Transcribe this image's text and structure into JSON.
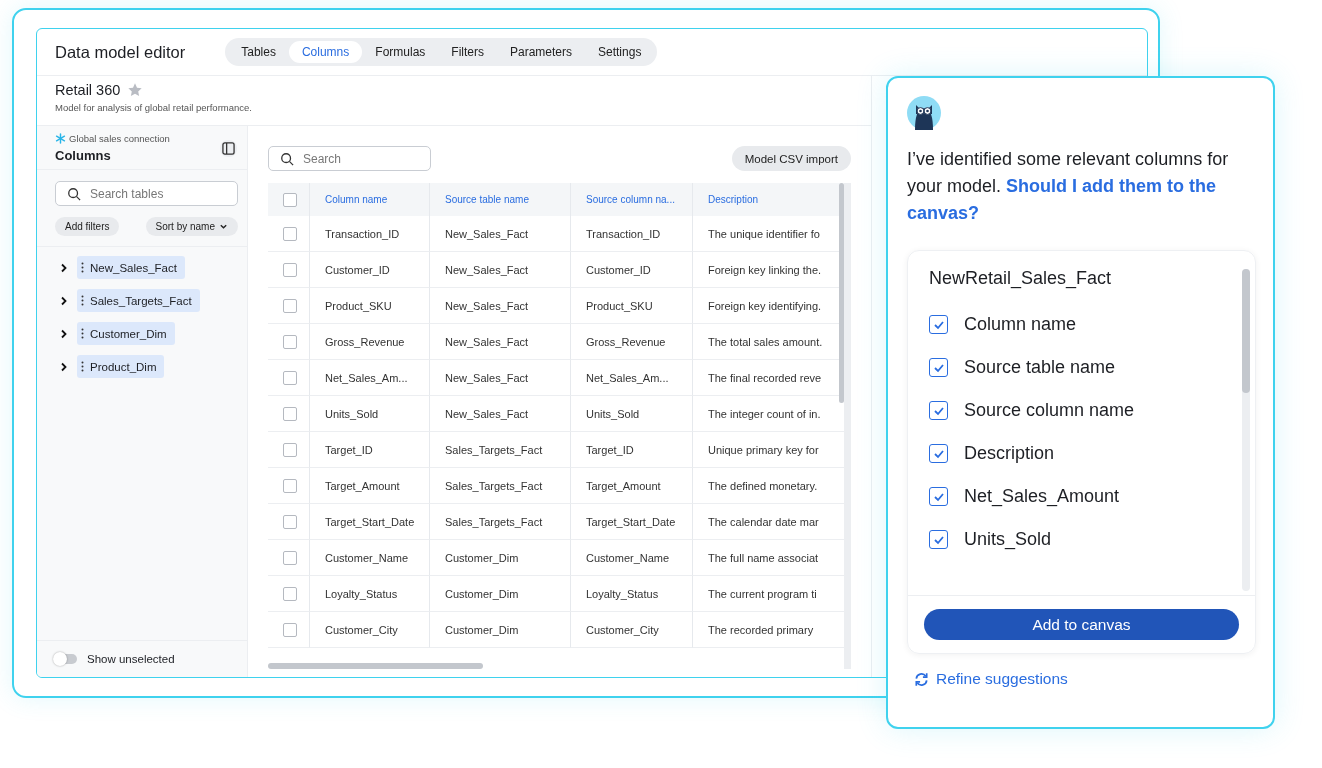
{
  "app": {
    "title": "Data model editor"
  },
  "tabs": [
    {
      "label": "Tables",
      "selected": false
    },
    {
      "label": "Columns",
      "selected": true
    },
    {
      "label": "Formulas",
      "selected": false
    },
    {
      "label": "Filters",
      "selected": false
    },
    {
      "label": "Parameters",
      "selected": false
    },
    {
      "label": "Settings",
      "selected": false
    }
  ],
  "model": {
    "name": "Retail 360",
    "starred": false,
    "description": "Model for analysis of global retail performance."
  },
  "sidebar": {
    "connection": "Global sales connection",
    "title": "Columns",
    "search": {
      "placeholder": "Search tables"
    },
    "buttons": [
      {
        "label": "Add filters",
        "kind": "plain"
      },
      {
        "label": "Sort by name",
        "kind": "dropdown"
      }
    ],
    "tables": [
      {
        "name": "New_Sales_Fact",
        "expanded": false
      },
      {
        "name": "Sales_Targets_Fact",
        "expanded": false
      },
      {
        "name": "Customer_Dim",
        "expanded": false
      },
      {
        "name": "Product_Dim",
        "expanded": false
      }
    ],
    "toggle": {
      "label": "Show unselected",
      "on": false
    }
  },
  "main": {
    "search": {
      "placeholder": "Search"
    },
    "import_button": "Model CSV import",
    "table": {
      "all_checked": false,
      "columns": [
        "Column name",
        "Source table name",
        "Source column na...",
        "Description"
      ],
      "rows": [
        {
          "checked": false,
          "cells": [
            "Transaction_ID",
            "New_Sales_Fact",
            "Transaction_ID",
            "The unique identifier fo"
          ]
        },
        {
          "checked": false,
          "cells": [
            "Customer_ID",
            "New_Sales_Fact",
            "Customer_ID",
            "Foreign key linking the."
          ]
        },
        {
          "checked": false,
          "cells": [
            "Product_SKU",
            "New_Sales_Fact",
            "Product_SKU",
            "Foreign key identifying."
          ]
        },
        {
          "checked": false,
          "cells": [
            "Gross_Revenue",
            "New_Sales_Fact",
            "Gross_Revenue",
            "The total sales amount."
          ]
        },
        {
          "checked": false,
          "cells": [
            "Net_Sales_Am...",
            "New_Sales_Fact",
            "Net_Sales_Am...",
            "The final recorded reve"
          ]
        },
        {
          "checked": false,
          "cells": [
            "Units_Sold",
            "New_Sales_Fact",
            "Units_Sold",
            "The integer count of in."
          ]
        },
        {
          "checked": false,
          "cells": [
            "Target_ID",
            "Sales_Targets_Fact",
            "Target_ID",
            "Unique primary key for"
          ]
        },
        {
          "checked": false,
          "cells": [
            "Target_Amount",
            "Sales_Targets_Fact",
            "Target_Amount",
            "The defined monetary."
          ]
        },
        {
          "checked": false,
          "cells": [
            "Target_Start_Date",
            "Sales_Targets_Fact",
            "Target_Start_Date",
            "The calendar date mar"
          ]
        },
        {
          "checked": false,
          "cells": [
            "Customer_Name",
            "Customer_Dim",
            "Customer_Name",
            "The full name associat"
          ]
        },
        {
          "checked": false,
          "cells": [
            "Loyalty_Status",
            "Customer_Dim",
            "Loyalty_Status",
            "The current program ti"
          ]
        },
        {
          "checked": false,
          "cells": [
            "Customer_City",
            "Customer_Dim",
            "Customer_City",
            "The recorded primary"
          ]
        }
      ]
    }
  },
  "assistant": {
    "message": "I’ve identified some relevant columns for your model. **Should I add them to the canvas?**",
    "groups": [
      {
        "title": "NewRetail_Sales_Fact",
        "items": [
          {
            "label": "Column name",
            "checked": true
          },
          {
            "label": "Source table name",
            "checked": true
          },
          {
            "label": "Source column name",
            "checked": true
          },
          {
            "label": "Description",
            "checked": true
          },
          {
            "label": "Net_Sales_Amount",
            "checked": true
          },
          {
            "label": "Units_Sold",
            "checked": true
          }
        ]
      }
    ],
    "primary_button": "Add to canvas",
    "link": "Refine suggestions"
  }
}
